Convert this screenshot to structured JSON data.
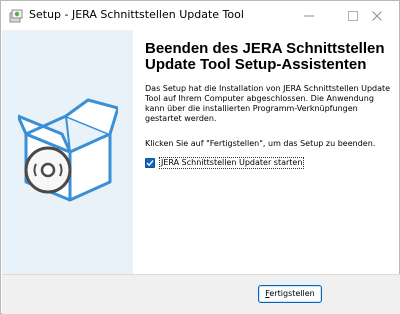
{
  "window": {
    "title": "Setup - JERA Schnittstellen Update Tool",
    "controls": [
      "minimize",
      "maximize",
      "close"
    ]
  },
  "sidebar": {
    "illustration": "software-box-with-disc-icon"
  },
  "content": {
    "heading": "Beenden des JERA Schnittstellen Update Tool Setup-Assistenten",
    "paragraph1": "Das Setup hat die Installation von JERA Schnittstellen Update Tool auf Ihrem Computer abgeschlossen. Die Anwendung kann über die installierten Programm-Verknüpfungen gestartet werden.",
    "paragraph2": "Klicken Sie auf \"Fertigstellen\", um das Setup zu beenden.",
    "launch_checkbox": {
      "label": "JERA Schnittstellen Updater starten",
      "checked": true
    }
  },
  "footer": {
    "finish_button": {
      "label_first": "F",
      "label_rest": "ertigstellen"
    }
  },
  "colors": {
    "accent": "#1565c0",
    "sidebar_bg": "#e9f2f9",
    "box_blue": "#3b8fd6"
  }
}
